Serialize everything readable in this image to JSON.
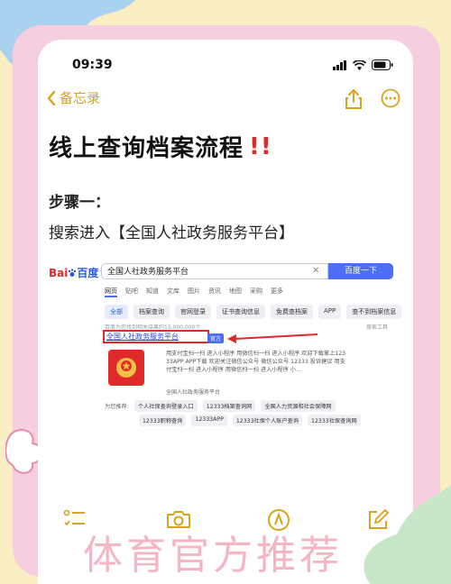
{
  "status_bar": {
    "time": "09:39"
  },
  "nav": {
    "back_label": "备忘录"
  },
  "note": {
    "title": "线上查询档案流程",
    "title_mark": "!!",
    "step_label": "步骤一：",
    "step_desc": "搜索进入【全国人社政务服务平台】"
  },
  "baidu": {
    "logo_part1": "Bai",
    "logo_part2": "百度",
    "query": "全国人社政务服务平台",
    "search_button": "百度一下",
    "tabs": [
      "Q全部",
      "网页",
      "贴吧",
      "知道",
      "文库",
      "图片",
      "资讯",
      "地图",
      "采购",
      "更多"
    ],
    "pills": [
      "全部",
      "档案查询",
      "官网登录",
      "证书查询信息",
      "免费查档案",
      "APP",
      "查不到档案信息",
      "档案"
    ],
    "result_count": "百度为您找到相关结果约15,000,000个",
    "search_tools": "搜索工具",
    "result_title": "全国人社政务服务平台",
    "official_badge": "官方",
    "snippet_lines": [
      "用支付宝扫一扫 进入小程序 用微信扫一扫 进入小程序 欢迎下载掌上123",
      "33APP APP下载 欢迎关注微信公众号 微信公众号 12333 投诉建议 用支",
      "付宝扫一扫 进入小程序 用微信扫一扫 进入小程序 小..."
    ],
    "site_name": "全国人社政务服务平台",
    "recommend_label": "为您推荐:",
    "recommend_row1": [
      "个人社保查询登录入口",
      "12333档案查询网",
      "全国人力资源和社会保障网"
    ],
    "recommend_row2": [
      "12333职称查询",
      "12333APP",
      "12333社保个人账户查询",
      "12333社保查询网"
    ]
  },
  "watermark": "体育官方推荐",
  "colors": {
    "accent": "#d9a31b",
    "baidu_blue": "#4e6ef2",
    "highlight_red": "#e02a2a"
  }
}
